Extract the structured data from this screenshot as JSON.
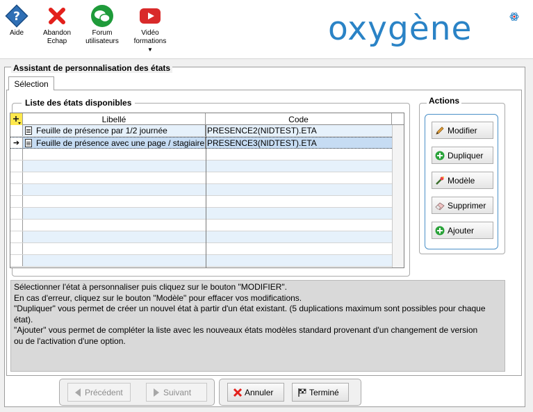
{
  "toolbar": {
    "aide": "Aide",
    "abandon_line1": "Abandon",
    "abandon_line2": "Echap",
    "forum_line1": "Forum",
    "forum_line2": "utilisateurs",
    "video_line1": "Vidéo",
    "video_line2": "formations",
    "logo": "oxygène"
  },
  "wizard": {
    "title": "Assistant de personnalisation des états",
    "tab": "Sélection",
    "list_group_title": "Liste des états disponibles",
    "columns": {
      "libelle": "Libellé",
      "code": "Code"
    },
    "rows": [
      {
        "libelle": "Feuille de présence par 1/2 journée",
        "code": "PRESENCE2(NIDTEST).ETA"
      },
      {
        "libelle": "Feuille de présence avec une page / stagiaire",
        "code": "PRESENCE3(NIDTEST).ETA"
      }
    ],
    "actions_title": "Actions",
    "actions": {
      "modifier": "Modifier",
      "dupliquer": "Dupliquer",
      "modele": "Modèle",
      "supprimer": "Supprimer",
      "ajouter": "Ajouter"
    },
    "info": {
      "line1": "Sélectionner l'état à personnaliser puis cliquez sur le bouton \"MODIFIER\".",
      "line2": "En cas d'erreur, cliquez sur le bouton \"Modèle\" pour effacer vos modifications.",
      "line3": "\"Dupliquer\" vous permet de créer un nouvel état à partir d'un état existant. (5 duplications maximum sont possibles pour chaque état).",
      "line4": "\"Ajouter\" vous permet de compléter la liste avec les nouveaux états modèles standard provenant d'un changement de version",
      "line5": "ou de l'activation d'une option."
    }
  },
  "nav": {
    "precedent": "Précédent",
    "suivant": "Suivant",
    "annuler": "Annuler",
    "termine": "Terminé"
  },
  "colors": {
    "brand": "#2a83c6",
    "row_alt": "#e6f1fb",
    "row_selected": "#c6dcf3",
    "info_bg": "#d9d9d9"
  }
}
